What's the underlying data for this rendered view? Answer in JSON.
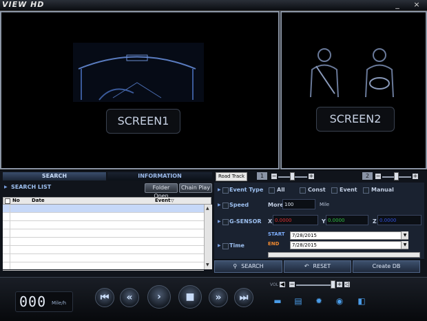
{
  "app": {
    "title": "VIEW HD",
    "minimize": "_",
    "close": "×"
  },
  "screens": {
    "screen1_label": "SCREEN1",
    "screen2_label": "SCREEN2"
  },
  "tabs": [
    {
      "label": "SEARCH",
      "active": true
    },
    {
      "label": "INFORMATION",
      "active": false
    }
  ],
  "toolbar": {
    "road_track": "Road Track",
    "ch1": "1",
    "ch2": "2",
    "minus": "−",
    "plus": "+"
  },
  "search_list": {
    "title": "SEARCH LIST",
    "folder_open": "Folder Open",
    "chain_play": "Chain Play",
    "columns": [
      "No",
      "Date",
      "Event"
    ],
    "row_count": 9,
    "selected_row": 0
  },
  "filters": {
    "event_type": {
      "label": "Event Type",
      "options": [
        "All",
        "Const",
        "Event",
        "Manual"
      ]
    },
    "speed": {
      "label": "Speed",
      "prefix": "More",
      "value": "100",
      "unit": "Mile"
    },
    "gsensor": {
      "label": "G-SENSOR",
      "x_label": "X",
      "x_value": "0.0000",
      "y_label": "Y",
      "y_value": "0.0000",
      "z_label": "Z",
      "z_value": "0.0000"
    },
    "time": {
      "label": "Time",
      "start_label": "START",
      "start_value": "7/28/2015",
      "end_label": "END",
      "end_value": "7/28/2015"
    }
  },
  "actions": {
    "search": "SEARCH",
    "reset": "RESET",
    "create_db": "Create DB"
  },
  "player": {
    "speed_value": "000",
    "speed_unit": "Mile/h",
    "vol_label": "VOL",
    "volume_level": 0.9,
    "buttons": {
      "prev": "⏮",
      "rewind": "«",
      "play": "›",
      "stop": "■",
      "forward": "»",
      "next": "⏭"
    }
  },
  "colors": {
    "accent": "#4a9ce8",
    "panel": "#10141b",
    "x_value": "#e03030",
    "y_value": "#30c040",
    "z_value": "#3050e0",
    "start": "#7fb0ff",
    "end": "#f08a30"
  }
}
